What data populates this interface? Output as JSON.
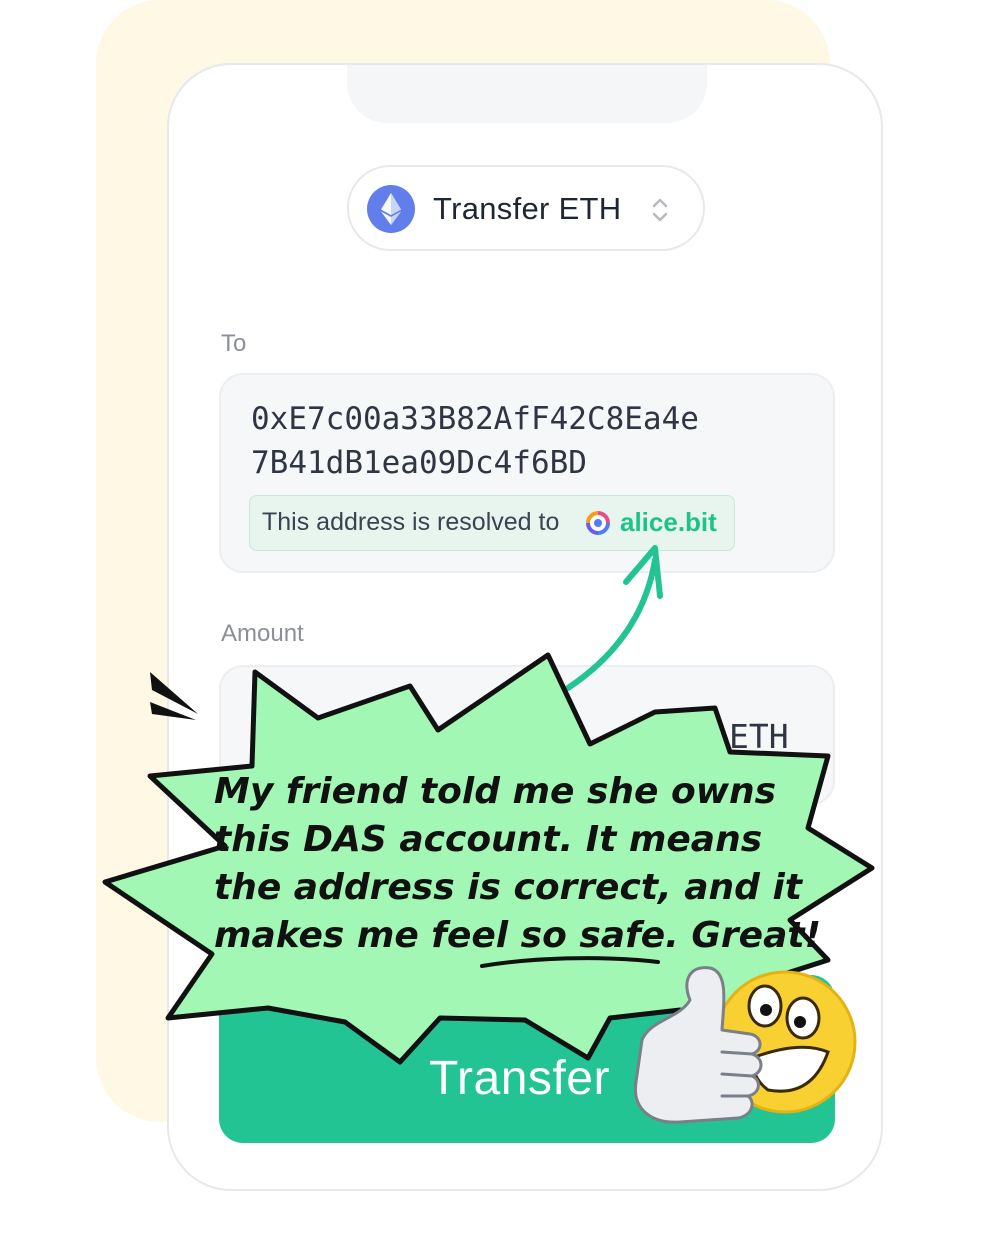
{
  "header": {
    "token_label": "Transfer ETH",
    "token_icon": "ethereum-icon"
  },
  "to": {
    "label": "To",
    "address_line1": "0xE7c00a33B82AfF42C8Ea4e",
    "address_line2": "7B41dB1ea09Dc4f6BD",
    "resolved_text": "This address is resolved to",
    "alias_icon": "das-logo-icon",
    "alias": "alice.bit"
  },
  "amount": {
    "label": "Amount",
    "unit": "ETH"
  },
  "transfer_button": {
    "label": "Transfer"
  },
  "speech": {
    "line1": "My friend told me she owns",
    "line2": "this DAS account. It means",
    "line3": "the address is correct, and it",
    "line4_pre": "makes me feel ",
    "line4_emph": "so safe",
    "line4_post": ". Great!"
  },
  "colors": {
    "accent": "#22c493",
    "alias": "#1ec28b",
    "bubble": "#a3f7b5",
    "ethereum": "#627eea",
    "emoji": "#f9d031",
    "background_card": "#fef8e4"
  }
}
